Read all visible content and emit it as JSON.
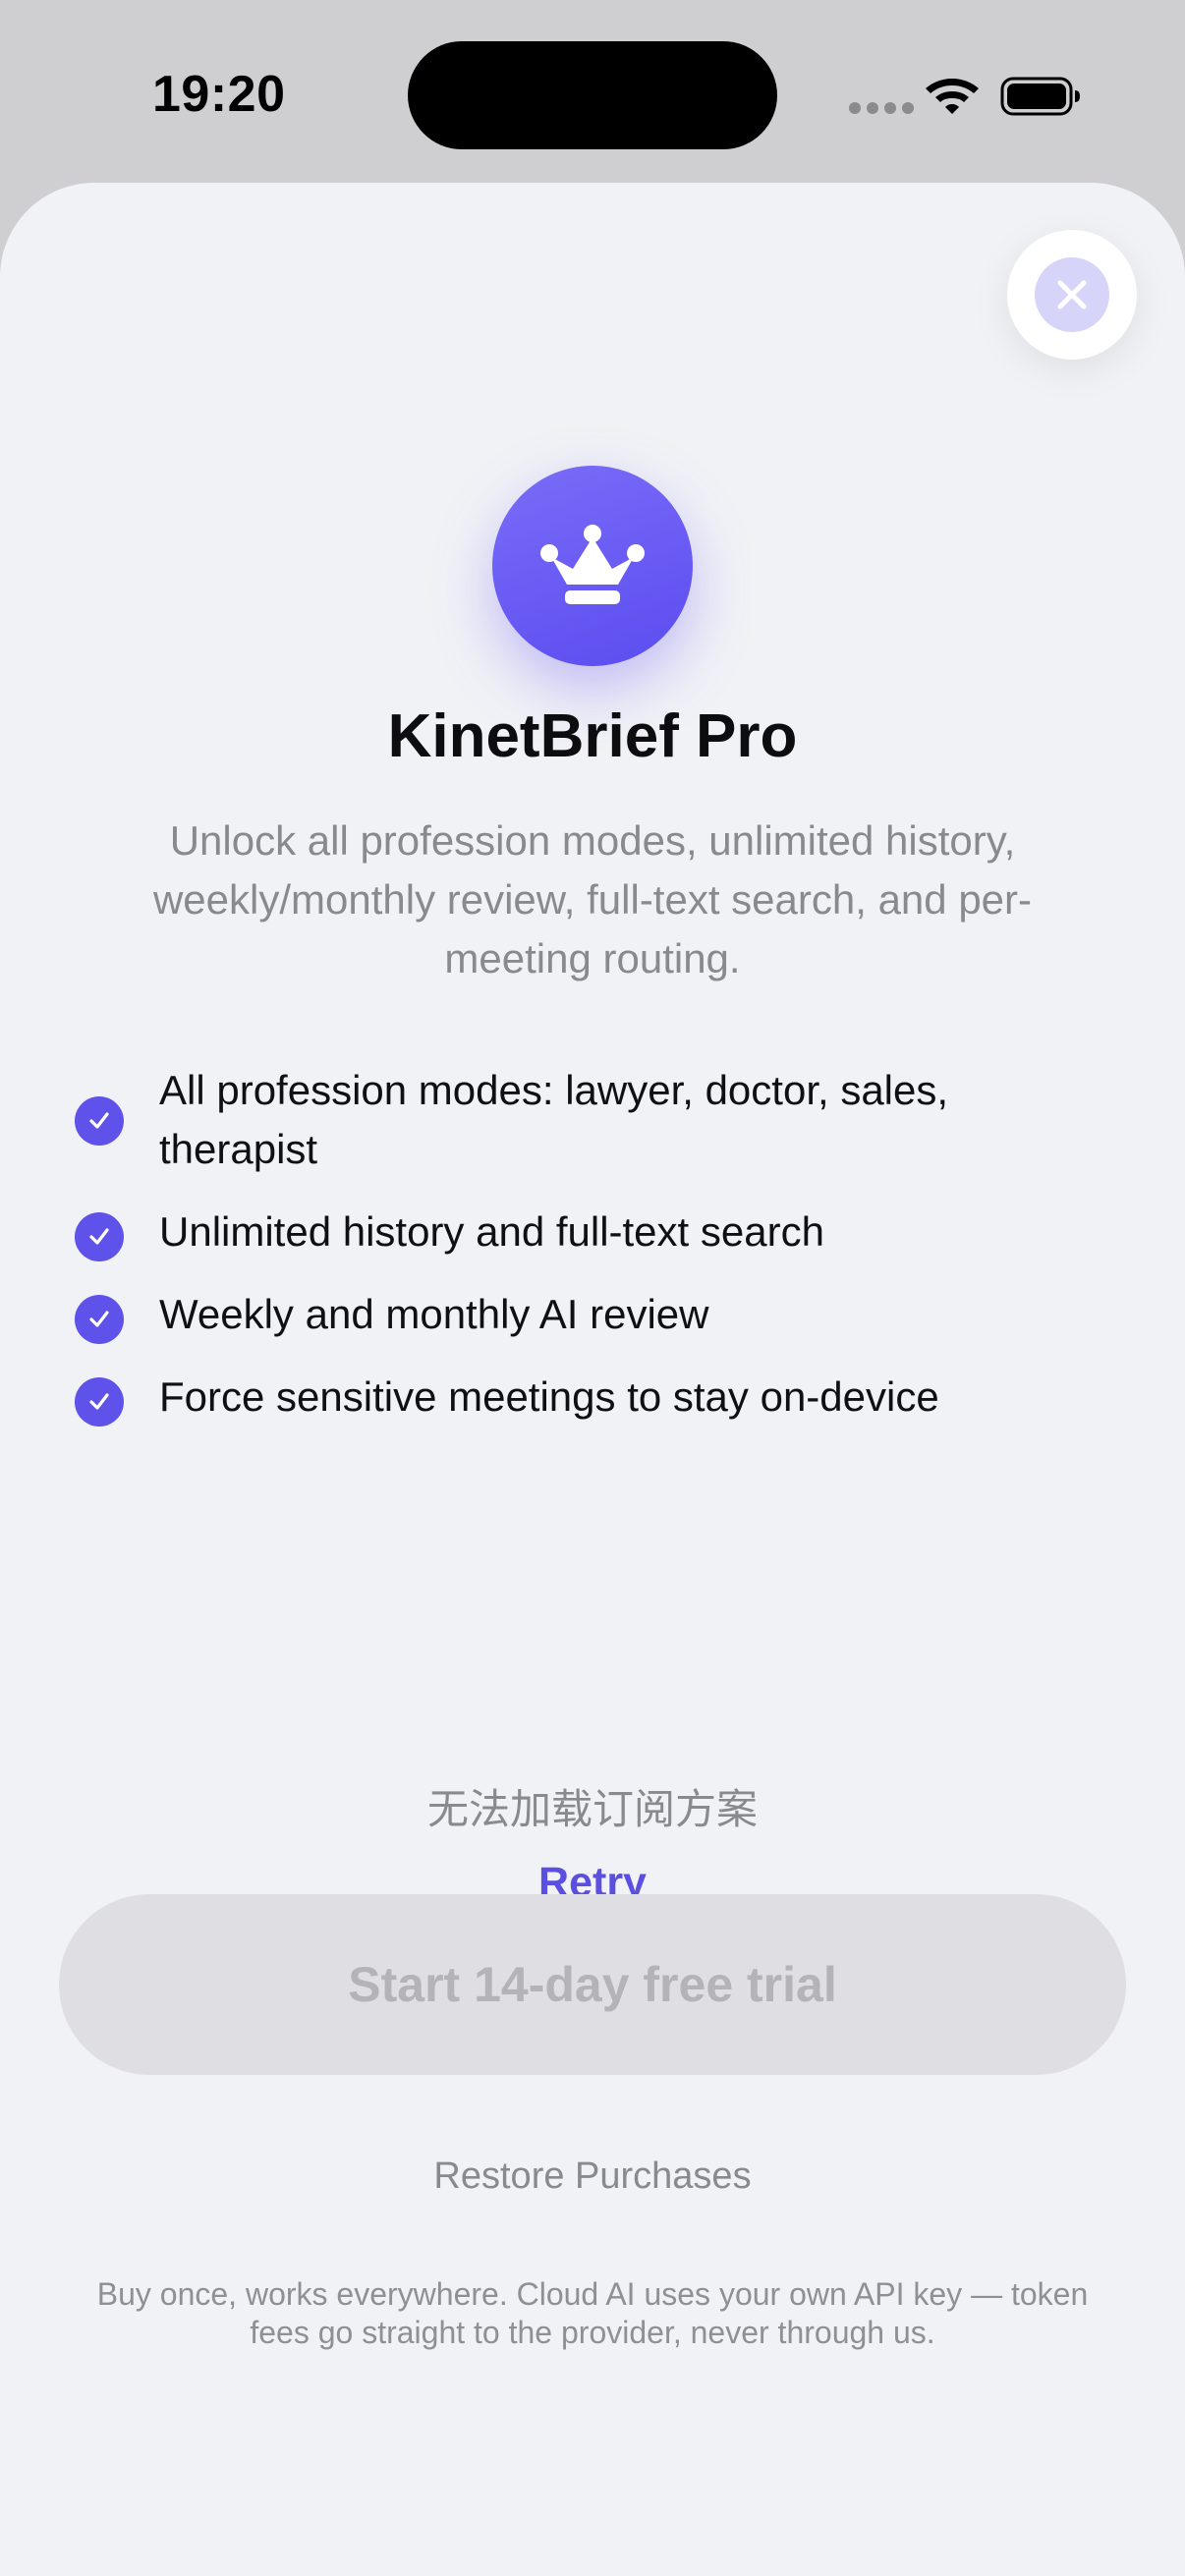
{
  "status_bar": {
    "time": "19:20"
  },
  "paywall": {
    "icon": "crown-icon",
    "title": "KinetBrief Pro",
    "subtitle": "Unlock all profession modes, unlimited history, weekly/monthly review, full-text search, and per-meeting routing.",
    "features": [
      {
        "icon": "checkmark-icon",
        "label": "All profession modes: lawyer, doctor, sales, therapist"
      },
      {
        "icon": "checkmark-icon",
        "label": "Unlimited history and full-text search"
      },
      {
        "icon": "checkmark-icon",
        "label": "Weekly and monthly AI review"
      },
      {
        "icon": "checkmark-icon",
        "label": "Force sensitive meetings to stay on-device"
      }
    ],
    "error_message": "无法加载订阅方案",
    "retry_label": "Retry",
    "cta_label": "Start 14-day free trial",
    "restore_label": "Restore Purchases",
    "disclaimer": "Buy once, works everywhere. Cloud AI uses your own API key — token fees go straight to the provider, never through us."
  },
  "colors": {
    "accent": "#5E52EA",
    "sheet_background": "#F1F2F6",
    "disabled_button": "#DFDFE3"
  }
}
